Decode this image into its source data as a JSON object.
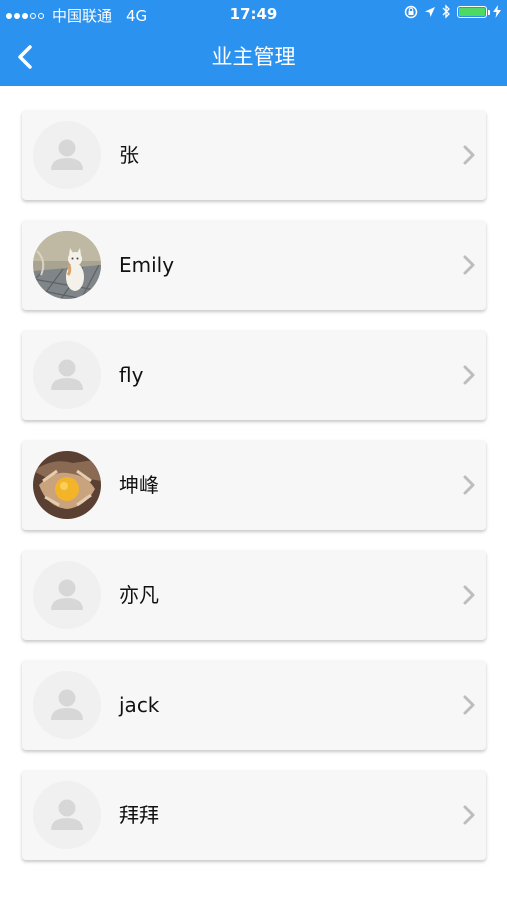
{
  "status_bar": {
    "carrier": "中国联通",
    "network": "4G",
    "time": "17:49"
  },
  "nav": {
    "title": "业主管理"
  },
  "colors": {
    "primary": "#2b92f0",
    "battery": "#4cd964",
    "card_bg": "#f7f7f7"
  },
  "owners": [
    {
      "name": "张",
      "avatar": "default-avatar-icon"
    },
    {
      "name": "Emily",
      "avatar": "cat-photo"
    },
    {
      "name": "fly",
      "avatar": "default-avatar-icon"
    },
    {
      "name": "坤峰",
      "avatar": "food-photo"
    },
    {
      "name": "亦凡",
      "avatar": "default-avatar-icon"
    },
    {
      "name": "jack",
      "avatar": "default-avatar-icon"
    },
    {
      "name": "拜拜",
      "avatar": "default-avatar-icon"
    }
  ]
}
